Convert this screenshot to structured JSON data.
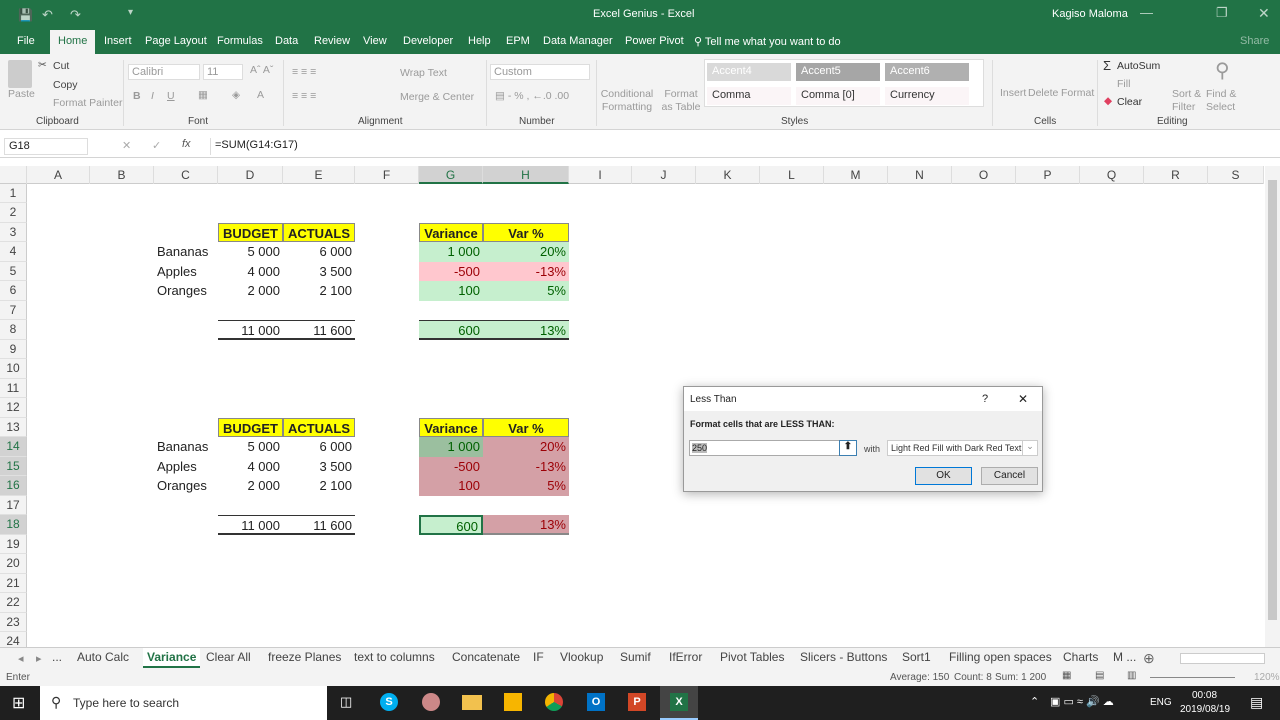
{
  "window": {
    "title": "Excel Genius  -  Excel",
    "user": "Kagiso Maloma",
    "share": "Share"
  },
  "menu": [
    "File",
    "Home",
    "Insert",
    "Page Layout",
    "Formulas",
    "Data",
    "Review",
    "View",
    "Developer",
    "Help",
    "EPM",
    "Data Manager",
    "Power Pivot"
  ],
  "tell_me": "Tell me what you want to do",
  "ribbon": {
    "clipboard": {
      "paste": "Paste",
      "cut": "Cut",
      "copy": "Copy",
      "format_painter": "Format Painter",
      "label": "Clipboard"
    },
    "font": {
      "name": "Calibri",
      "size": "11",
      "label": "Font"
    },
    "alignment": {
      "wrap": "Wrap Text",
      "merge": "Merge & Center",
      "label": "Alignment"
    },
    "number": {
      "format": "Custom",
      "label": "Number"
    },
    "styles": {
      "conditional": "Conditional Formatting",
      "format_table": "Format as Table",
      "items": [
        "Accent4",
        "Accent5",
        "Accent6",
        "Comma",
        "Comma [0]",
        "Currency"
      ],
      "label": "Styles"
    },
    "cells": {
      "insert": "Insert",
      "delete": "Delete",
      "format": "Format",
      "label": "Cells"
    },
    "editing": {
      "autosum": "AutoSum",
      "fill": "Fill",
      "clear": "Clear",
      "sort": "Sort & Filter",
      "find": "Find & Select",
      "label": "Editing"
    }
  },
  "formula_bar": {
    "name_box": "G18",
    "formula": "=SUM(G14:G17)"
  },
  "columns": [
    "A",
    "B",
    "C",
    "D",
    "E",
    "F",
    "G",
    "H",
    "I",
    "J",
    "K",
    "L",
    "M",
    "N",
    "O",
    "P",
    "Q",
    "R",
    "S"
  ],
  "selected_columns": [
    "G",
    "H"
  ],
  "selected_rows": [
    14,
    15,
    16,
    18
  ],
  "rows": [
    1,
    2,
    3,
    4,
    5,
    6,
    7,
    8,
    9,
    10,
    11,
    12,
    13,
    14,
    15,
    16,
    17,
    18,
    19,
    20,
    21,
    22,
    23,
    24
  ],
  "colors": {
    "accent": "#217346",
    "header_yellow": "#ffff00",
    "green_fill": "#c6efce",
    "green_text": "#006100",
    "red_fill": "#ffc7ce",
    "red_text": "#9c0006"
  },
  "cells": [
    {
      "c": "D",
      "r": 3,
      "v": "BUDGET",
      "s": "hdr"
    },
    {
      "c": "E",
      "r": 3,
      "v": "ACTUALS",
      "s": "hdr"
    },
    {
      "c": "G",
      "r": 3,
      "v": "Variance",
      "s": "hdr"
    },
    {
      "c": "H",
      "r": 3,
      "v": "Var %",
      "s": "hdr"
    },
    {
      "c": "C",
      "r": 4,
      "v": "Bananas",
      "s": "lbl"
    },
    {
      "c": "D",
      "r": 4,
      "v": "5 000"
    },
    {
      "c": "E",
      "r": 4,
      "v": "6 000"
    },
    {
      "c": "G",
      "r": 4,
      "v": "1 000",
      "s": "g"
    },
    {
      "c": "H",
      "r": 4,
      "v": "20%",
      "s": "g"
    },
    {
      "c": "C",
      "r": 5,
      "v": "Apples",
      "s": "lbl"
    },
    {
      "c": "D",
      "r": 5,
      "v": "4 000"
    },
    {
      "c": "E",
      "r": 5,
      "v": "3 500"
    },
    {
      "c": "G",
      "r": 5,
      "v": "-500",
      "s": "rd"
    },
    {
      "c": "H",
      "r": 5,
      "v": "-13%",
      "s": "rd"
    },
    {
      "c": "C",
      "r": 6,
      "v": "Oranges",
      "s": "lbl"
    },
    {
      "c": "D",
      "r": 6,
      "v": "2 000"
    },
    {
      "c": "E",
      "r": 6,
      "v": "2 100"
    },
    {
      "c": "G",
      "r": 6,
      "v": "100",
      "s": "g"
    },
    {
      "c": "H",
      "r": 6,
      "v": "5%",
      "s": "g"
    },
    {
      "c": "D",
      "r": 8,
      "v": "11 000",
      "s": "tot"
    },
    {
      "c": "E",
      "r": 8,
      "v": "11 600",
      "s": "tot"
    },
    {
      "c": "G",
      "r": 8,
      "v": "600",
      "s": "gt"
    },
    {
      "c": "H",
      "r": 8,
      "v": "13%",
      "s": "gt"
    },
    {
      "c": "D",
      "r": 13,
      "v": "BUDGET",
      "s": "hdr"
    },
    {
      "c": "E",
      "r": 13,
      "v": "ACTUALS",
      "s": "hdr"
    },
    {
      "c": "G",
      "r": 13,
      "v": "Variance",
      "s": "hdr"
    },
    {
      "c": "H",
      "r": 13,
      "v": "Var %",
      "s": "hdr"
    },
    {
      "c": "C",
      "r": 14,
      "v": "Bananas",
      "s": "lbl"
    },
    {
      "c": "D",
      "r": 14,
      "v": "5 000"
    },
    {
      "c": "E",
      "r": 14,
      "v": "6 000"
    },
    {
      "c": "G",
      "r": 14,
      "v": "1 000",
      "s": "gs"
    },
    {
      "c": "H",
      "r": 14,
      "v": "20%",
      "s": "rs"
    },
    {
      "c": "C",
      "r": 15,
      "v": "Apples",
      "s": "lbl"
    },
    {
      "c": "D",
      "r": 15,
      "v": "4 000"
    },
    {
      "c": "E",
      "r": 15,
      "v": "3 500"
    },
    {
      "c": "G",
      "r": 15,
      "v": "-500",
      "s": "rs"
    },
    {
      "c": "H",
      "r": 15,
      "v": "-13%",
      "s": "rs"
    },
    {
      "c": "C",
      "r": 16,
      "v": "Oranges",
      "s": "lbl"
    },
    {
      "c": "D",
      "r": 16,
      "v": "2 000"
    },
    {
      "c": "E",
      "r": 16,
      "v": "2 100"
    },
    {
      "c": "G",
      "r": 16,
      "v": "100",
      "s": "rs"
    },
    {
      "c": "H",
      "r": 16,
      "v": "5%",
      "s": "rs"
    },
    {
      "c": "D",
      "r": 18,
      "v": "11 000",
      "s": "tot"
    },
    {
      "c": "E",
      "r": 18,
      "v": "11 600",
      "s": "tot"
    },
    {
      "c": "G",
      "r": 18,
      "v": "600",
      "s": "active"
    },
    {
      "c": "H",
      "r": 18,
      "v": "13%",
      "s": "rst"
    }
  ],
  "dialog": {
    "title": "Less Than",
    "help": "?",
    "prompt": "Format cells that are LESS THAN:",
    "value": "250",
    "with": "with",
    "format": "Light Red Fill with Dark Red Text",
    "ok": "OK",
    "cancel": "Cancel"
  },
  "sheet_tabs": [
    "...",
    "Auto Calc",
    "Variance",
    "Clear All",
    "freeze Planes",
    "text to columns",
    "Concatenate",
    "IF",
    "Vlookup",
    "Sumif",
    "IfError",
    "Pivot Tables",
    "Slicers - Buttons",
    "Sort1",
    "Filling open spaces",
    "Charts",
    "M ..."
  ],
  "active_tab": "Variance",
  "status": {
    "mode": "Enter",
    "average": "Average: 150",
    "count": "Count: 8",
    "sum": "Sum: 1 200",
    "zoom": "120%"
  },
  "taskbar": {
    "search": "Type here to search",
    "lang": "ENG",
    "time": "00:08",
    "date": "2019/08/19"
  }
}
